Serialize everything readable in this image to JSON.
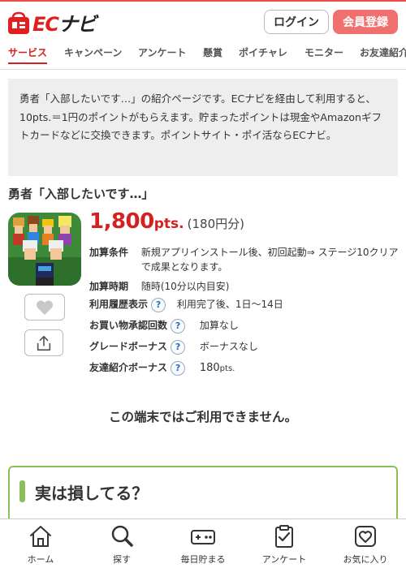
{
  "header": {
    "logo_text_ec": "EC",
    "logo_text_navi": "ナビ",
    "login_label": "ログイン",
    "register_label": "会員登録"
  },
  "nav": {
    "items": [
      {
        "label": "サービス",
        "active": true
      },
      {
        "label": "キャンペーン"
      },
      {
        "label": "アンケート"
      },
      {
        "label": "懸賞"
      },
      {
        "label": "ポイチャレ"
      },
      {
        "label": "モニター"
      },
      {
        "label": "お友達紹介"
      }
    ]
  },
  "intro": {
    "text": "勇者「入部したいです…」の紹介ページです。ECナビを経由して利用すると、10pts.＝1円のポイントがもらえます。貯まったポイントは現金やAmazonギフトカードなどに交換できます。ポイントサイト・ポイ活ならECナビ。"
  },
  "offer": {
    "title": "勇者「入部したいです…」",
    "points_value": "1,800",
    "points_unit": "pts.",
    "yen_equivalent": "(180円分)",
    "details": [
      {
        "label": "加算条件",
        "value": "新規アプリインストール後、初回起動⇒ ステージ10クリア",
        "value2": "で成果となります。"
      },
      {
        "label": "加算時期",
        "value": "随時(10分以内目安)"
      },
      {
        "label": "利用履歴表示",
        "value": "利用完了後、1日～14日",
        "help": "?"
      },
      {
        "label": "お買い物承認回数",
        "value": "加算なし",
        "help": "?"
      },
      {
        "label": "グレードボーナス",
        "value": "ボーナスなし",
        "help": "?"
      },
      {
        "label": "友達紹介ボーナス",
        "value": "180",
        "value_unit": "pts.",
        "help": "?"
      }
    ],
    "unavailable_text": "この端末ではご利用できません。"
  },
  "promo_box": {
    "title": "実は損してる？"
  },
  "tabbar": {
    "items": [
      {
        "label": "ホーム",
        "icon": "home-icon"
      },
      {
        "label": "探す",
        "icon": "search-icon"
      },
      {
        "label": "毎日貯まる",
        "icon": "gamepad-icon"
      },
      {
        "label": "アンケート",
        "icon": "clipboard-check-icon"
      },
      {
        "label": "お気に入り",
        "icon": "heart-icon"
      }
    ]
  },
  "colors": {
    "brand_red": "#d42020",
    "register_button": "#f07070",
    "promo_green": "#8bbf5a"
  }
}
